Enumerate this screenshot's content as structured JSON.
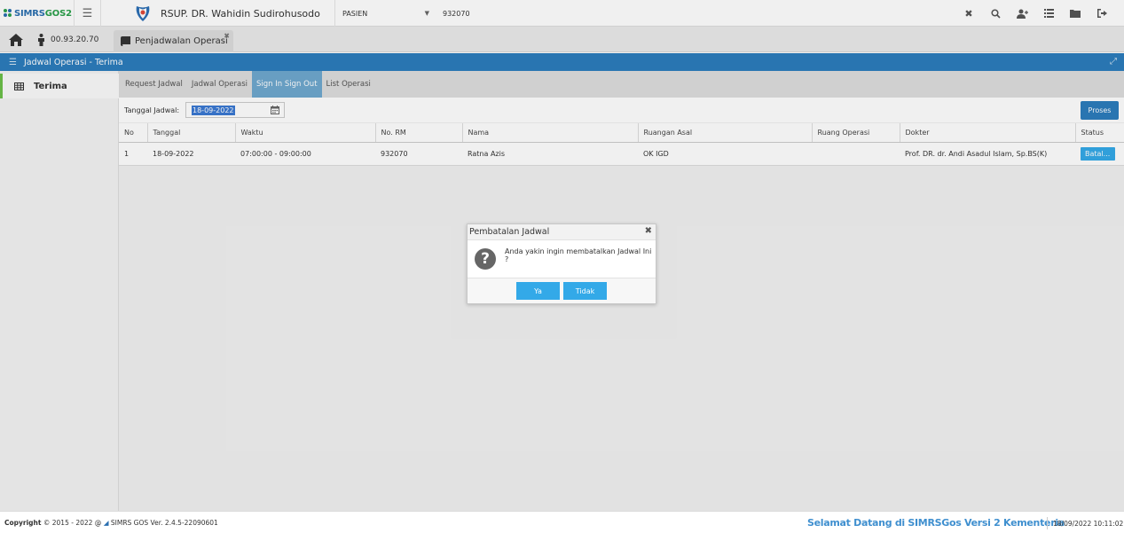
{
  "app": {
    "logo_main": "SIMRS",
    "logo_accent": "GOS2",
    "hospital_name": "RSUP. DR. Wahidin Sudirohusodo"
  },
  "topbar": {
    "patient_select": "PASIEN",
    "rm_value": "932070"
  },
  "tabrow": {
    "ip_label": "00.93.20.70",
    "tab_label": "Penjadwalan Operasi"
  },
  "panel": {
    "title": "Jadwal Operasi - Terima"
  },
  "sidebar": {
    "items": [
      {
        "label": "Terima"
      }
    ]
  },
  "subtabs": [
    {
      "label": "Request Jadwal"
    },
    {
      "label": "Jadwal Operasi"
    },
    {
      "label": "Sign In Sign Out"
    },
    {
      "label": "List Operasi"
    }
  ],
  "filter": {
    "label": "Tanggal Jadwal:",
    "date_value": "18-09-2022",
    "button_label": "Proses"
  },
  "table": {
    "headers": [
      "No",
      "Tanggal",
      "Waktu",
      "No. RM",
      "Nama",
      "Ruangan Asal",
      "Ruang Operasi",
      "Dokter",
      "Status"
    ],
    "rows": [
      {
        "no": "1",
        "tanggal": "18-09-2022",
        "waktu": "07:00:00 - 09:00:00",
        "no_rm": "932070",
        "nama": "Ratna Azis",
        "ruangan_asal": "OK IGD",
        "ruang_operasi": "",
        "dokter": "Prof. DR. dr. Andi Asadul Islam, Sp.BS(K)",
        "status": "Batal..."
      }
    ]
  },
  "dialog": {
    "title": "Pembatalan Jadwal",
    "message": "Anda yakin ingin membatalkan Jadwal Ini ?",
    "yes_label": "Ya",
    "no_label": "Tidak"
  },
  "footer": {
    "copyright_label": "Copyright",
    "copyright_years": "2015 - 2022 @",
    "version": "SIMRS GOS Ver. 2.4.5-22090601",
    "welcome": "Selamat Datang di SIMRSGos Versi 2 Kementeria",
    "datetime": "18/09/2022 10:11:02"
  },
  "colors": {
    "primary": "#2c7dbd",
    "accent_button": "#33a9e8",
    "active_subtab": "#6fa8cf",
    "sidebar_marker": "#6cc04a"
  },
  "icons": [
    "menu-icon",
    "close-icon",
    "search-icon",
    "user-add-icon",
    "list-icon",
    "folder-icon",
    "logout-icon",
    "home-icon",
    "person-icon",
    "book-icon",
    "table-icon",
    "calendar-icon",
    "expand-icon",
    "question-icon"
  ]
}
